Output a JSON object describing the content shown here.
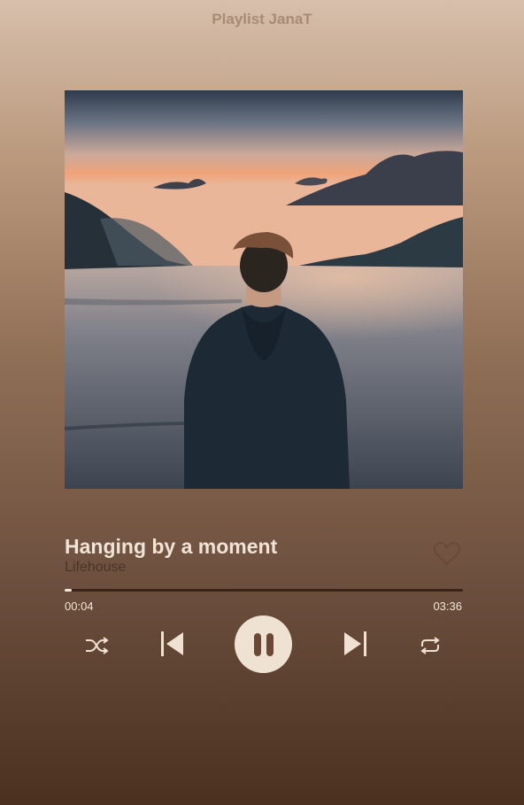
{
  "header": {
    "title": "Playlist JanaT"
  },
  "track": {
    "title": "Hanging by a moment",
    "artist": "Lifehouse",
    "current_time": "00:04",
    "total_time": "03:36",
    "progress": 0.018,
    "liked": false
  },
  "controls": {
    "shuffle_icon": "shuffle-icon",
    "prev_icon": "skip-previous-icon",
    "play_pause_icon": "pause-icon",
    "next_icon": "skip-next-icon",
    "repeat_icon": "repeat-icon",
    "like_icon": "heart-outline-icon"
  },
  "colors": {
    "accent_light": "#efe2d3",
    "icon_dark": "#6a4a36",
    "progress_track": "#3a2418"
  }
}
